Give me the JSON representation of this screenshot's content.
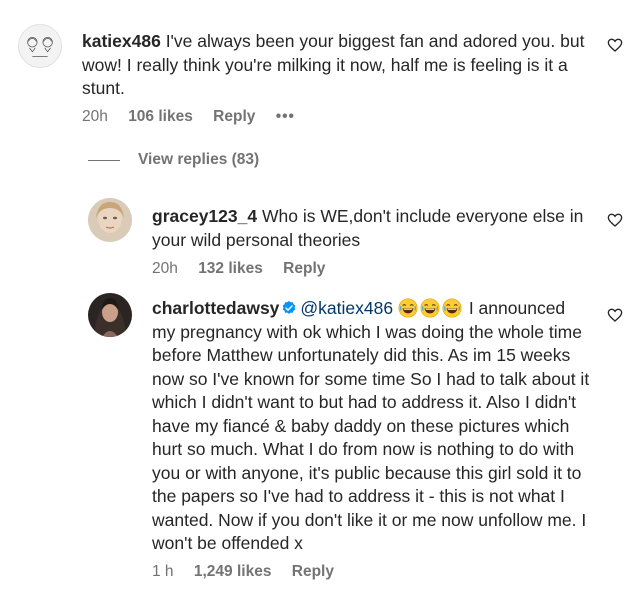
{
  "comments": [
    {
      "username": "katiex486",
      "text": " I've always been your biggest fan and adored you. but wow! I really think you're milking it now, half me is feeling is it a stunt.",
      "time": "20h",
      "likes": "106 likes",
      "reply": "Reply",
      "more": "•••"
    },
    {
      "username": "gracey123_4",
      "text": " Who is WE,don't include everyone else in your wild personal theories",
      "time": "20h",
      "likes": "132 likes",
      "reply": "Reply"
    },
    {
      "username": "charlottedawsy",
      "mention": "@katiex486",
      "text": " I announced my pregnancy with ok which I was doing the whole time before Matthew unfortunately did this. As im 15 weeks now so I've known for some time So I had to talk about it which I didn't want to but had to address it. Also I didn't have my fiancé & baby daddy on these pictures which hurt so much. What I do from now is nothing to do with you or with anyone, it's public because this girl sold it to the papers so I've had to address it - this is not what I wanted. Now if you don't like it or me now unfollow me. I won't be offended x",
      "time": "1 h",
      "likes": "1,249 likes",
      "reply": "Reply"
    }
  ],
  "view_replies": "View replies (83)",
  "colors": {
    "text": "#262626",
    "secondary": "#737373",
    "mention": "#00376b",
    "verified": "#0095f6"
  },
  "icons": [
    "heart-icon",
    "verified-badge-icon",
    "laughing-emoji-icon"
  ]
}
